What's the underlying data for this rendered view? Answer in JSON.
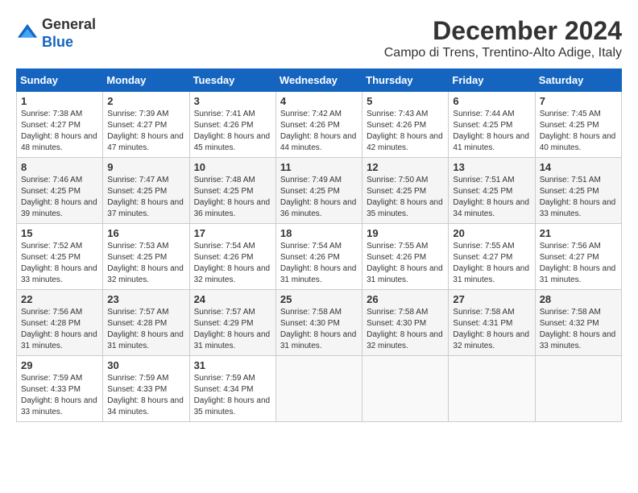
{
  "header": {
    "logo_line1": "General",
    "logo_line2": "Blue",
    "month_title": "December 2024",
    "location": "Campo di Trens, Trentino-Alto Adige, Italy"
  },
  "weekdays": [
    "Sunday",
    "Monday",
    "Tuesday",
    "Wednesday",
    "Thursday",
    "Friday",
    "Saturday"
  ],
  "weeks": [
    [
      {
        "day": "1",
        "sunrise": "7:38 AM",
        "sunset": "4:27 PM",
        "daylight": "8 hours and 48 minutes."
      },
      {
        "day": "2",
        "sunrise": "7:39 AM",
        "sunset": "4:27 PM",
        "daylight": "8 hours and 47 minutes."
      },
      {
        "day": "3",
        "sunrise": "7:41 AM",
        "sunset": "4:26 PM",
        "daylight": "8 hours and 45 minutes."
      },
      {
        "day": "4",
        "sunrise": "7:42 AM",
        "sunset": "4:26 PM",
        "daylight": "8 hours and 44 minutes."
      },
      {
        "day": "5",
        "sunrise": "7:43 AM",
        "sunset": "4:26 PM",
        "daylight": "8 hours and 42 minutes."
      },
      {
        "day": "6",
        "sunrise": "7:44 AM",
        "sunset": "4:25 PM",
        "daylight": "8 hours and 41 minutes."
      },
      {
        "day": "7",
        "sunrise": "7:45 AM",
        "sunset": "4:25 PM",
        "daylight": "8 hours and 40 minutes."
      }
    ],
    [
      {
        "day": "8",
        "sunrise": "7:46 AM",
        "sunset": "4:25 PM",
        "daylight": "8 hours and 39 minutes."
      },
      {
        "day": "9",
        "sunrise": "7:47 AM",
        "sunset": "4:25 PM",
        "daylight": "8 hours and 37 minutes."
      },
      {
        "day": "10",
        "sunrise": "7:48 AM",
        "sunset": "4:25 PM",
        "daylight": "8 hours and 36 minutes."
      },
      {
        "day": "11",
        "sunrise": "7:49 AM",
        "sunset": "4:25 PM",
        "daylight": "8 hours and 36 minutes."
      },
      {
        "day": "12",
        "sunrise": "7:50 AM",
        "sunset": "4:25 PM",
        "daylight": "8 hours and 35 minutes."
      },
      {
        "day": "13",
        "sunrise": "7:51 AM",
        "sunset": "4:25 PM",
        "daylight": "8 hours and 34 minutes."
      },
      {
        "day": "14",
        "sunrise": "7:51 AM",
        "sunset": "4:25 PM",
        "daylight": "8 hours and 33 minutes."
      }
    ],
    [
      {
        "day": "15",
        "sunrise": "7:52 AM",
        "sunset": "4:25 PM",
        "daylight": "8 hours and 33 minutes."
      },
      {
        "day": "16",
        "sunrise": "7:53 AM",
        "sunset": "4:25 PM",
        "daylight": "8 hours and 32 minutes."
      },
      {
        "day": "17",
        "sunrise": "7:54 AM",
        "sunset": "4:26 PM",
        "daylight": "8 hours and 32 minutes."
      },
      {
        "day": "18",
        "sunrise": "7:54 AM",
        "sunset": "4:26 PM",
        "daylight": "8 hours and 31 minutes."
      },
      {
        "day": "19",
        "sunrise": "7:55 AM",
        "sunset": "4:26 PM",
        "daylight": "8 hours and 31 minutes."
      },
      {
        "day": "20",
        "sunrise": "7:55 AM",
        "sunset": "4:27 PM",
        "daylight": "8 hours and 31 minutes."
      },
      {
        "day": "21",
        "sunrise": "7:56 AM",
        "sunset": "4:27 PM",
        "daylight": "8 hours and 31 minutes."
      }
    ],
    [
      {
        "day": "22",
        "sunrise": "7:56 AM",
        "sunset": "4:28 PM",
        "daylight": "8 hours and 31 minutes."
      },
      {
        "day": "23",
        "sunrise": "7:57 AM",
        "sunset": "4:28 PM",
        "daylight": "8 hours and 31 minutes."
      },
      {
        "day": "24",
        "sunrise": "7:57 AM",
        "sunset": "4:29 PM",
        "daylight": "8 hours and 31 minutes."
      },
      {
        "day": "25",
        "sunrise": "7:58 AM",
        "sunset": "4:30 PM",
        "daylight": "8 hours and 31 minutes."
      },
      {
        "day": "26",
        "sunrise": "7:58 AM",
        "sunset": "4:30 PM",
        "daylight": "8 hours and 32 minutes."
      },
      {
        "day": "27",
        "sunrise": "7:58 AM",
        "sunset": "4:31 PM",
        "daylight": "8 hours and 32 minutes."
      },
      {
        "day": "28",
        "sunrise": "7:58 AM",
        "sunset": "4:32 PM",
        "daylight": "8 hours and 33 minutes."
      }
    ],
    [
      {
        "day": "29",
        "sunrise": "7:59 AM",
        "sunset": "4:33 PM",
        "daylight": "8 hours and 33 minutes."
      },
      {
        "day": "30",
        "sunrise": "7:59 AM",
        "sunset": "4:33 PM",
        "daylight": "8 hours and 34 minutes."
      },
      {
        "day": "31",
        "sunrise": "7:59 AM",
        "sunset": "4:34 PM",
        "daylight": "8 hours and 35 minutes."
      },
      null,
      null,
      null,
      null
    ]
  ]
}
